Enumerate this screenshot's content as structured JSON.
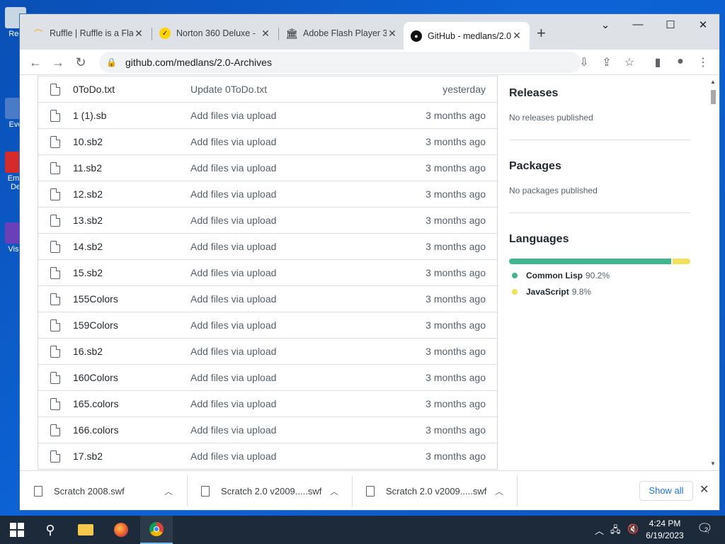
{
  "desktop": {
    "icons": [
      {
        "label": "Rec"
      },
      {
        "label": "Eve"
      },
      {
        "label": "Emb De"
      },
      {
        "label": "Visu"
      }
    ]
  },
  "tabs": [
    {
      "title": "Ruffle | Ruffle is a Flash",
      "icon": "ruffle-icon"
    },
    {
      "title": "Norton 360 Deluxe - ",
      "icon": "norton-icon"
    },
    {
      "title": "Adobe Flash Player 3",
      "icon": "archive-icon"
    },
    {
      "title": "GitHub - medlans/2.0",
      "icon": "github-icon",
      "active": true
    }
  ],
  "address": {
    "url": "github.com/medlans/2.0-Archives"
  },
  "files": [
    {
      "name": "0ToDo.txt",
      "message": "Update 0ToDo.txt",
      "date": "yesterday"
    },
    {
      "name": "1 (1).sb",
      "message": "Add files via upload",
      "date": "3 months ago"
    },
    {
      "name": "10.sb2",
      "message": "Add files via upload",
      "date": "3 months ago"
    },
    {
      "name": "11.sb2",
      "message": "Add files via upload",
      "date": "3 months ago"
    },
    {
      "name": "12.sb2",
      "message": "Add files via upload",
      "date": "3 months ago"
    },
    {
      "name": "13.sb2",
      "message": "Add files via upload",
      "date": "3 months ago"
    },
    {
      "name": "14.sb2",
      "message": "Add files via upload",
      "date": "3 months ago"
    },
    {
      "name": "15.sb2",
      "message": "Add files via upload",
      "date": "3 months ago"
    },
    {
      "name": "155Colors",
      "message": "Add files via upload",
      "date": "3 months ago"
    },
    {
      "name": "159Colors",
      "message": "Add files via upload",
      "date": "3 months ago"
    },
    {
      "name": "16.sb2",
      "message": "Add files via upload",
      "date": "3 months ago"
    },
    {
      "name": "160Colors",
      "message": "Add files via upload",
      "date": "3 months ago"
    },
    {
      "name": "165.colors",
      "message": "Add files via upload",
      "date": "3 months ago"
    },
    {
      "name": "166.colors",
      "message": "Add files via upload",
      "date": "3 months ago"
    },
    {
      "name": "17.sb2",
      "message": "Add files via upload",
      "date": "3 months ago"
    }
  ],
  "sidebar": {
    "releases": {
      "title": "Releases",
      "text": "No releases published"
    },
    "packages": {
      "title": "Packages",
      "text": "No packages published"
    },
    "languages": {
      "title": "Languages",
      "items": [
        {
          "name": "Common Lisp",
          "percent": "90.2%",
          "value": 90.2,
          "color": "#3fb68b"
        },
        {
          "name": "JavaScript",
          "percent": "9.8%",
          "value": 9.8,
          "color": "#f1e05a"
        }
      ]
    }
  },
  "downloads": {
    "items": [
      {
        "name": "Scratch 2008.swf"
      },
      {
        "name": "Scratch 2.0 v2009.....swf"
      },
      {
        "name": "Scratch 2.0 v2009.....swf"
      }
    ],
    "show_all": "Show all"
  },
  "taskbar": {
    "time": "4:24 PM",
    "date": "6/19/2023",
    "notification_count": "2"
  }
}
